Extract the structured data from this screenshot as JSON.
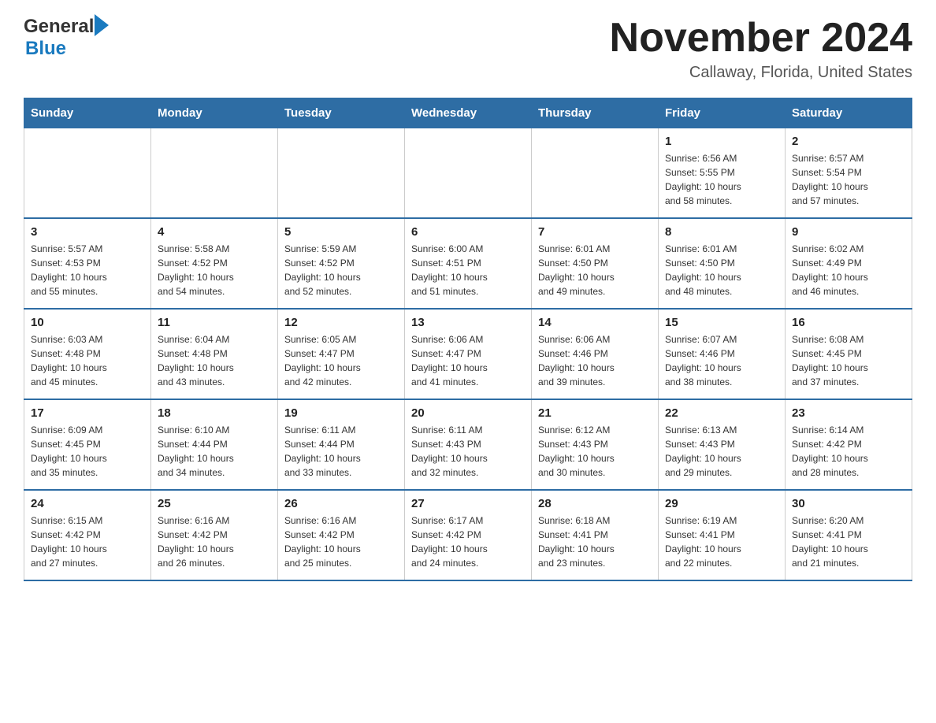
{
  "header": {
    "logo_general": "General",
    "logo_blue": "Blue",
    "month_title": "November 2024",
    "location": "Callaway, Florida, United States"
  },
  "weekdays": [
    "Sunday",
    "Monday",
    "Tuesday",
    "Wednesday",
    "Thursday",
    "Friday",
    "Saturday"
  ],
  "weeks": [
    [
      {
        "day": "",
        "info": ""
      },
      {
        "day": "",
        "info": ""
      },
      {
        "day": "",
        "info": ""
      },
      {
        "day": "",
        "info": ""
      },
      {
        "day": "",
        "info": ""
      },
      {
        "day": "1",
        "info": "Sunrise: 6:56 AM\nSunset: 5:55 PM\nDaylight: 10 hours\nand 58 minutes."
      },
      {
        "day": "2",
        "info": "Sunrise: 6:57 AM\nSunset: 5:54 PM\nDaylight: 10 hours\nand 57 minutes."
      }
    ],
    [
      {
        "day": "3",
        "info": "Sunrise: 5:57 AM\nSunset: 4:53 PM\nDaylight: 10 hours\nand 55 minutes."
      },
      {
        "day": "4",
        "info": "Sunrise: 5:58 AM\nSunset: 4:52 PM\nDaylight: 10 hours\nand 54 minutes."
      },
      {
        "day": "5",
        "info": "Sunrise: 5:59 AM\nSunset: 4:52 PM\nDaylight: 10 hours\nand 52 minutes."
      },
      {
        "day": "6",
        "info": "Sunrise: 6:00 AM\nSunset: 4:51 PM\nDaylight: 10 hours\nand 51 minutes."
      },
      {
        "day": "7",
        "info": "Sunrise: 6:01 AM\nSunset: 4:50 PM\nDaylight: 10 hours\nand 49 minutes."
      },
      {
        "day": "8",
        "info": "Sunrise: 6:01 AM\nSunset: 4:50 PM\nDaylight: 10 hours\nand 48 minutes."
      },
      {
        "day": "9",
        "info": "Sunrise: 6:02 AM\nSunset: 4:49 PM\nDaylight: 10 hours\nand 46 minutes."
      }
    ],
    [
      {
        "day": "10",
        "info": "Sunrise: 6:03 AM\nSunset: 4:48 PM\nDaylight: 10 hours\nand 45 minutes."
      },
      {
        "day": "11",
        "info": "Sunrise: 6:04 AM\nSunset: 4:48 PM\nDaylight: 10 hours\nand 43 minutes."
      },
      {
        "day": "12",
        "info": "Sunrise: 6:05 AM\nSunset: 4:47 PM\nDaylight: 10 hours\nand 42 minutes."
      },
      {
        "day": "13",
        "info": "Sunrise: 6:06 AM\nSunset: 4:47 PM\nDaylight: 10 hours\nand 41 minutes."
      },
      {
        "day": "14",
        "info": "Sunrise: 6:06 AM\nSunset: 4:46 PM\nDaylight: 10 hours\nand 39 minutes."
      },
      {
        "day": "15",
        "info": "Sunrise: 6:07 AM\nSunset: 4:46 PM\nDaylight: 10 hours\nand 38 minutes."
      },
      {
        "day": "16",
        "info": "Sunrise: 6:08 AM\nSunset: 4:45 PM\nDaylight: 10 hours\nand 37 minutes."
      }
    ],
    [
      {
        "day": "17",
        "info": "Sunrise: 6:09 AM\nSunset: 4:45 PM\nDaylight: 10 hours\nand 35 minutes."
      },
      {
        "day": "18",
        "info": "Sunrise: 6:10 AM\nSunset: 4:44 PM\nDaylight: 10 hours\nand 34 minutes."
      },
      {
        "day": "19",
        "info": "Sunrise: 6:11 AM\nSunset: 4:44 PM\nDaylight: 10 hours\nand 33 minutes."
      },
      {
        "day": "20",
        "info": "Sunrise: 6:11 AM\nSunset: 4:43 PM\nDaylight: 10 hours\nand 32 minutes."
      },
      {
        "day": "21",
        "info": "Sunrise: 6:12 AM\nSunset: 4:43 PM\nDaylight: 10 hours\nand 30 minutes."
      },
      {
        "day": "22",
        "info": "Sunrise: 6:13 AM\nSunset: 4:43 PM\nDaylight: 10 hours\nand 29 minutes."
      },
      {
        "day": "23",
        "info": "Sunrise: 6:14 AM\nSunset: 4:42 PM\nDaylight: 10 hours\nand 28 minutes."
      }
    ],
    [
      {
        "day": "24",
        "info": "Sunrise: 6:15 AM\nSunset: 4:42 PM\nDaylight: 10 hours\nand 27 minutes."
      },
      {
        "day": "25",
        "info": "Sunrise: 6:16 AM\nSunset: 4:42 PM\nDaylight: 10 hours\nand 26 minutes."
      },
      {
        "day": "26",
        "info": "Sunrise: 6:16 AM\nSunset: 4:42 PM\nDaylight: 10 hours\nand 25 minutes."
      },
      {
        "day": "27",
        "info": "Sunrise: 6:17 AM\nSunset: 4:42 PM\nDaylight: 10 hours\nand 24 minutes."
      },
      {
        "day": "28",
        "info": "Sunrise: 6:18 AM\nSunset: 4:41 PM\nDaylight: 10 hours\nand 23 minutes."
      },
      {
        "day": "29",
        "info": "Sunrise: 6:19 AM\nSunset: 4:41 PM\nDaylight: 10 hours\nand 22 minutes."
      },
      {
        "day": "30",
        "info": "Sunrise: 6:20 AM\nSunset: 4:41 PM\nDaylight: 10 hours\nand 21 minutes."
      }
    ]
  ]
}
